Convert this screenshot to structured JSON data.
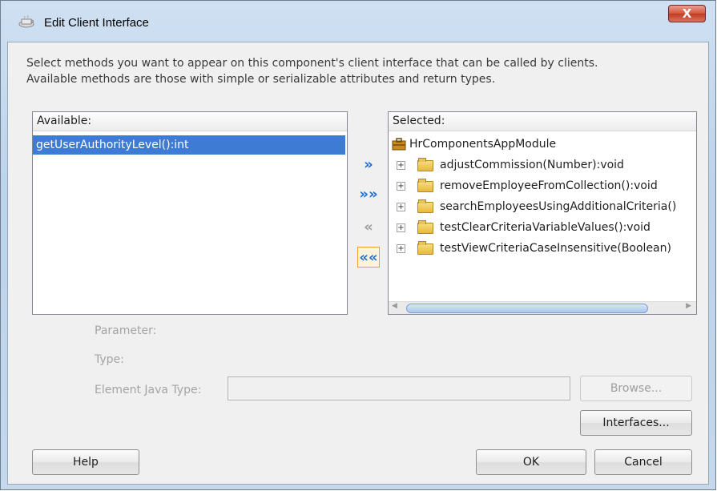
{
  "window": {
    "title": "Edit Client Interface",
    "close_glyph": "X"
  },
  "description": {
    "line1": "Select methods you want to appear on this component's client interface that can be called by clients.",
    "line2": "Available methods are those with simple or serializable attributes and return types."
  },
  "available": {
    "label": "Available:",
    "items": [
      "getUserAuthorityLevel():int"
    ]
  },
  "selected": {
    "label": "Selected:",
    "root": "HrComponentsAppModule",
    "items": [
      "adjustCommission(Number):void",
      "removeEmployeeFromCollection():void",
      "searchEmployeesUsingAdditionalCriteria()",
      "testClearCriteriaVariableValues():void",
      "testViewCriteriaCaseInsensitive(Boolean)"
    ]
  },
  "transfer": {
    "add_one": "»",
    "add_all": "»»",
    "remove_one": "«",
    "remove_all": "««"
  },
  "fields": {
    "parameter_label": "Parameter:",
    "type_label": "Type:",
    "element_java_type_label": "Element Java Type:",
    "element_java_type_value": ""
  },
  "buttons": {
    "browse": "Browse...",
    "interfaces": "Interfaces...",
    "help": "Help",
    "ok": "OK",
    "cancel": "Cancel"
  },
  "colors": {
    "selection": "#3d7bd5",
    "arrow_blue": "#1f6fd1",
    "arrow_gray": "#a0a0a0"
  }
}
